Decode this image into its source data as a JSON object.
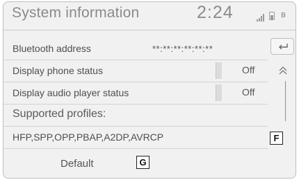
{
  "header": {
    "title": "System information",
    "clock": "2:24",
    "status_icons": [
      "signal-bars-icon",
      "battery-icon",
      "bluetooth-icon"
    ]
  },
  "rows": {
    "bluetooth_address": {
      "label": "Bluetooth address",
      "value": "**:**:**:**:**:**"
    },
    "display_phone_status": {
      "label": "Display phone status",
      "value": "Off"
    },
    "display_audio_player_status": {
      "label": "Display audio player status",
      "value": "Off"
    },
    "supported_profiles": {
      "label": "Supported profiles:"
    },
    "profiles_list": {
      "value": "HFP,SPP,OPP,PBAP,A2DP,AVRCP"
    }
  },
  "side": {
    "back_icon": "return-arrow-icon",
    "up_icon": "double-chevron-up-icon"
  },
  "default_button": {
    "label": "Default"
  },
  "callouts": {
    "f": "F",
    "g": "G"
  }
}
